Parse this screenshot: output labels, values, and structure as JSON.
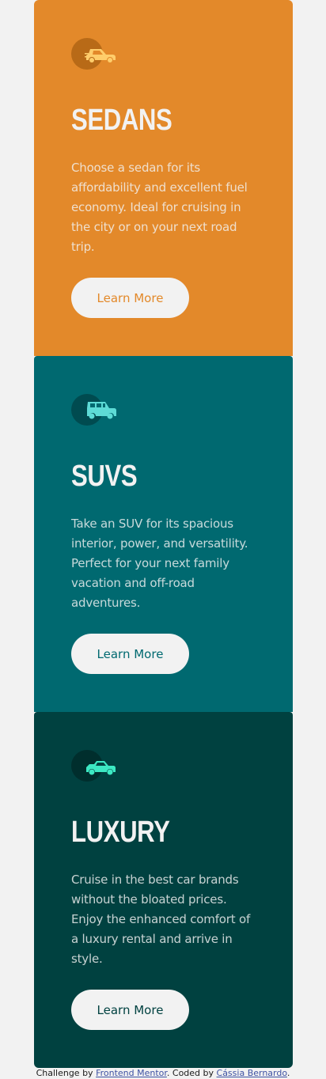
{
  "cards": [
    {
      "title": "Sedans",
      "icon": "sedan-icon",
      "description": "Choose a sedan for its affordability and excellent fuel economy. Ideal for cruising in the city or on your next road trip.",
      "button_label": "Learn More",
      "color": "#e3892a"
    },
    {
      "title": "SUVs",
      "icon": "suv-icon",
      "description": "Take an SUV for its spacious interior, power, and versatility. Perfect for your next family vacation and off-road adventures.",
      "button_label": "Learn More",
      "color": "#006970"
    },
    {
      "title": "Luxury",
      "icon": "luxury-car-icon",
      "description": "Cruise in the best car brands without the bloated prices. Enjoy the enhanced comfort of a luxury rental and arrive in style.",
      "button_label": "Learn More",
      "color": "#004140"
    }
  ],
  "footer": {
    "prefix": "Challenge by ",
    "challenge_link": "Frontend Mentor",
    "middle": ". Coded by ",
    "author_link": "Cássia Bernardo",
    "suffix": "."
  },
  "colors": {
    "background": "#f2f2f2",
    "text_light": "#f2f2f2",
    "link": "#3e52a3"
  }
}
